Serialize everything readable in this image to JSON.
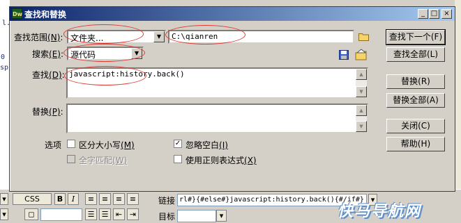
{
  "background": {
    "code_lines": [
      "l.h",
      "0",
      "sp"
    ],
    "bottom_bar": {
      "css_label": "CSS",
      "bold": "B",
      "italic": "I",
      "link_label": "链接",
      "link_value": "rl#}{#else#}javascript:history.back(){#/if#}",
      "target_label": "目标"
    }
  },
  "dialog": {
    "title": "查找和替换",
    "app_icon": "Dw",
    "window_buttons": [
      "_",
      "□",
      "×"
    ],
    "find_in": {
      "label": "查找范围",
      "mnemonic": "(N)",
      "value": "文件夹...",
      "path": "C:\\qianren"
    },
    "search": {
      "label": "搜索",
      "mnemonic": "(E)",
      "value": "源代码"
    },
    "find": {
      "label": "查找",
      "mnemonic": "(D)",
      "value": "javascript:history.back()"
    },
    "replace": {
      "label": "替换",
      "mnemonic": "(P)",
      "value": ""
    },
    "options": {
      "label": "选项",
      "match_case": {
        "label": "区分大小写",
        "mnemonic": "(M)",
        "checked": false
      },
      "whole_word": {
        "label": "全字匹配",
        "mnemonic": "(W)",
        "checked": false,
        "disabled": true
      },
      "ignore_whitespace": {
        "label": "忽略空白",
        "mnemonic": "(I)",
        "checked": true
      },
      "regex": {
        "label": "使用正则表达式",
        "mnemonic": "(X)",
        "checked": false
      }
    },
    "buttons": {
      "find_next": "查找下一个(F)",
      "find_all": "查找全部(L)",
      "replace": "替换(R)",
      "replace_all": "替换全部(A)",
      "close": "关闭(C)",
      "help": "帮助(H)"
    },
    "icons": [
      "folder-icon",
      "save-query-icon",
      "load-query-icon"
    ]
  },
  "watermark": "快马导航网",
  "colors": {
    "title_start": "#0a246a",
    "title_end": "#a6caf0",
    "annotation": "#e0382f"
  }
}
